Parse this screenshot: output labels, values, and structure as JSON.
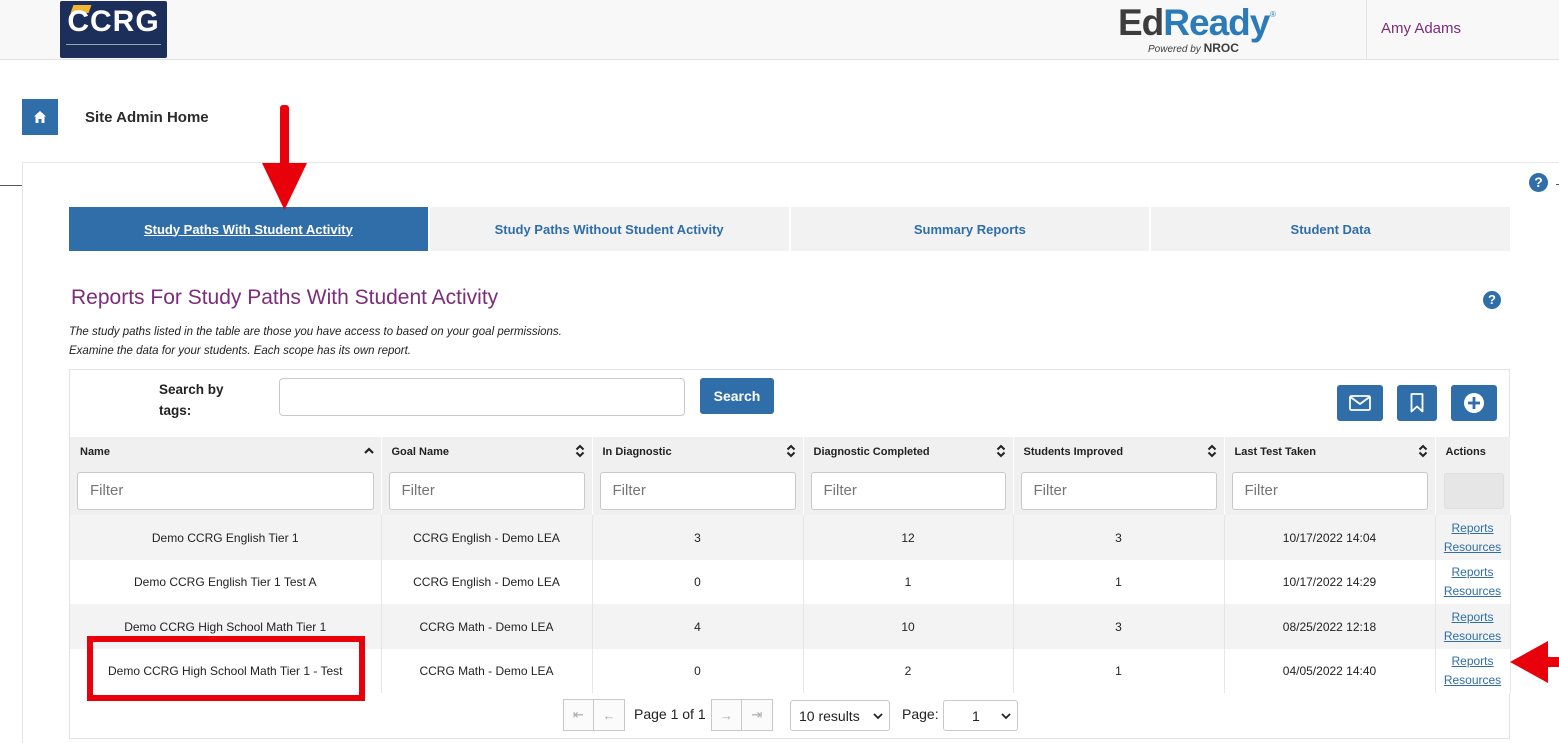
{
  "header": {
    "logo_text": "CCRG",
    "brand_ed": "Ed",
    "brand_ready": "Ready",
    "brand_reg": "®",
    "brand_powered": "Powered by",
    "brand_nroc": "NROC",
    "user_name": "Amy Adams"
  },
  "breadcrumb": {
    "home_icon": "home-icon",
    "label": "Site Admin Home"
  },
  "tabs": [
    {
      "label": "Study Paths With Student Activity",
      "active": true
    },
    {
      "label": "Study Paths Without Student Activity",
      "active": false
    },
    {
      "label": "Summary Reports",
      "active": false
    },
    {
      "label": "Student Data",
      "active": false
    }
  ],
  "help_glyph": "?",
  "section": {
    "title": "Reports For Study Paths With Student Activity",
    "desc1": "The study paths listed in the table are those you have access to based on your goal permissions.",
    "desc2": "Examine the data for your students. Each scope has its own report."
  },
  "search": {
    "label": "Search by tags:",
    "value": "",
    "button": "Search"
  },
  "toolbar_icons": [
    "mail-icon",
    "bookmark-icon",
    "add-circle-icon"
  ],
  "table": {
    "columns": [
      "Name",
      "Goal Name",
      "In Diagnostic",
      "Diagnostic Completed",
      "Students Improved",
      "Last Test Taken",
      "Actions"
    ],
    "filter_placeholder": "Filter",
    "rows": [
      {
        "name": "Demo CCRG English Tier 1",
        "goal": "CCRG English - Demo LEA",
        "in_diag": "3",
        "diag_completed": "12",
        "improved": "3",
        "last_test": "10/17/2022 14:04",
        "action1": "Reports",
        "action2": "Resources"
      },
      {
        "name": "Demo CCRG English Tier 1 Test A",
        "goal": "CCRG English - Demo LEA",
        "in_diag": "0",
        "diag_completed": "1",
        "improved": "1",
        "last_test": "10/17/2022 14:29",
        "action1": "Reports",
        "action2": "Resources"
      },
      {
        "name": "Demo CCRG High School Math Tier 1",
        "goal": "CCRG Math - Demo LEA",
        "in_diag": "4",
        "diag_completed": "10",
        "improved": "3",
        "last_test": "08/25/2022 12:18",
        "action1": "Reports",
        "action2": "Resources"
      },
      {
        "name": "Demo CCRG High School Math Tier 1 - Test",
        "goal": "CCRG Math - Demo LEA",
        "in_diag": "0",
        "diag_completed": "2",
        "improved": "1",
        "last_test": "04/05/2022 14:40",
        "action1": "Reports",
        "action2": "Resources"
      }
    ]
  },
  "pagination": {
    "first": "⇤",
    "prev": "←",
    "next": "→",
    "last": "⇥",
    "page_text": "Page 1 of 1",
    "results": "10 results",
    "page_label": "Page:",
    "page_value": "1"
  },
  "colors": {
    "primary": "#2f6ea8",
    "title_purple": "#7b2d7a",
    "annotation_red": "#e8000b"
  }
}
